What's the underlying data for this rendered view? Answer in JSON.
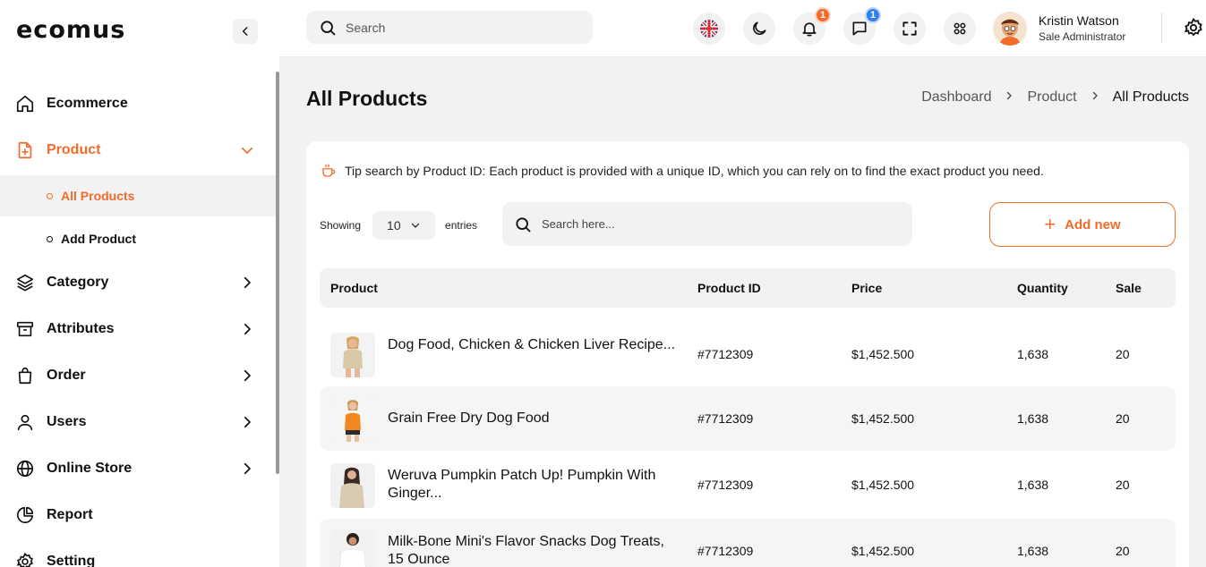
{
  "brand": {
    "logo": "ecomus",
    "accent": "#f26b2a"
  },
  "sidebar": {
    "items": [
      {
        "label": "Ecommerce",
        "icon": "home-icon"
      },
      {
        "label": "Product",
        "icon": "product-file-plus-icon",
        "active": true,
        "expanded": true,
        "subitems": [
          {
            "label": "All Products",
            "active": true
          },
          {
            "label": "Add Product"
          }
        ]
      },
      {
        "label": "Category",
        "icon": "layers-icon"
      },
      {
        "label": "Attributes",
        "icon": "archive-box-icon"
      },
      {
        "label": "Order",
        "icon": "shopping-bag-icon"
      },
      {
        "label": "Users",
        "icon": "user-icon"
      },
      {
        "label": "Online Store",
        "icon": "globe-icon"
      },
      {
        "label": "Report",
        "icon": "pie-chart-icon"
      },
      {
        "label": "Setting",
        "icon": "gear-icon"
      }
    ]
  },
  "topbar": {
    "search_placeholder": "Search",
    "notifications_count": "1",
    "messages_count": "1",
    "user": {
      "name": "Kristin Watson",
      "role": "Sale Administrator"
    }
  },
  "page": {
    "title": "All Products",
    "breadcrumb": [
      "Dashboard",
      "Product",
      "All Products"
    ]
  },
  "toolbar": {
    "tip": "Tip search by Product ID: Each product is provided with a unique ID, which you can rely on to find the exact product you need.",
    "showing_label": "Showing",
    "entries_value": "10",
    "entries_label": "entries",
    "search_placeholder": "Search here...",
    "add_label": "Add new"
  },
  "table": {
    "columns": [
      "Product",
      "Product ID",
      "Price",
      "Quantity",
      "Sale"
    ],
    "rows": [
      {
        "name": "Dog Food, Chicken & Chicken Liver Recipe...",
        "id": "#7712309",
        "price": "$1,452.500",
        "qty": "1,638",
        "sale": "20"
      },
      {
        "name": "Grain Free Dry Dog Food",
        "id": "#7712309",
        "price": "$1,452.500",
        "qty": "1,638",
        "sale": "20"
      },
      {
        "name": "Weruva Pumpkin Patch Up! Pumpkin With Ginger...",
        "id": "#7712309",
        "price": "$1,452.500",
        "qty": "1,638",
        "sale": "20"
      },
      {
        "name": "Milk-Bone Mini's Flavor Snacks Dog Treats, 15 Ounce",
        "id": "#7712309",
        "price": "$1,452.500",
        "qty": "1,638",
        "sale": "20"
      }
    ]
  }
}
